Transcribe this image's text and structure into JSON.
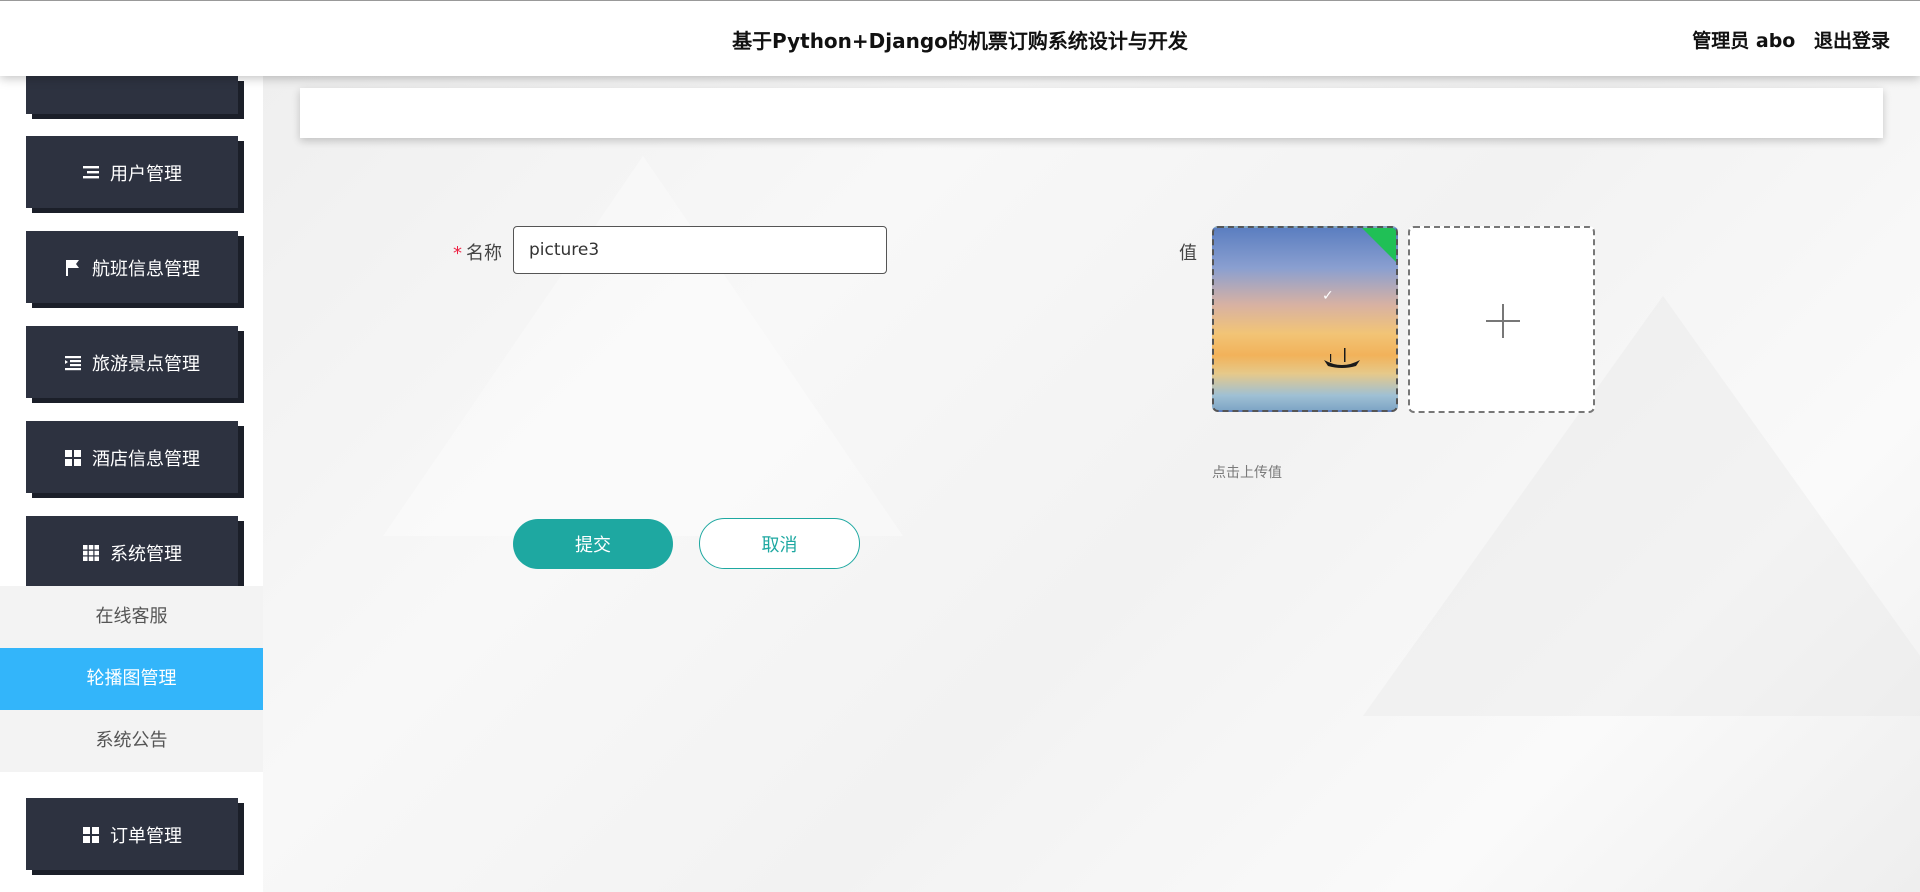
{
  "header": {
    "title": "基于Python+Django的机票订购系统设计与开发",
    "user_label": "管理员 abo",
    "logout_label": "退出登录"
  },
  "sidebar": {
    "items": [
      {
        "label": "用户管理",
        "icon": "list-icon"
      },
      {
        "label": "航班信息管理",
        "icon": "flag-icon"
      },
      {
        "label": "旅游景点管理",
        "icon": "indent-icon"
      },
      {
        "label": "酒店信息管理",
        "icon": "grid-icon"
      },
      {
        "label": "系统管理",
        "icon": "apps-icon"
      },
      {
        "label": "订单管理",
        "icon": "grid-icon"
      }
    ],
    "submenu": [
      {
        "label": "在线客服",
        "active": false
      },
      {
        "label": "轮播图管理",
        "active": true
      },
      {
        "label": "系统公告",
        "active": false
      }
    ]
  },
  "form": {
    "name_label": "名称",
    "name_required_mark": "*",
    "name_value": "picture3",
    "value_label": "值",
    "upload_hint": "点击上传值",
    "submit_label": "提交",
    "cancel_label": "取消"
  },
  "colors": {
    "sidebar_block": "#2d3240",
    "active_submenu": "#33b5fa",
    "primary": "#1ea8a1",
    "upload_success": "#20c056"
  }
}
